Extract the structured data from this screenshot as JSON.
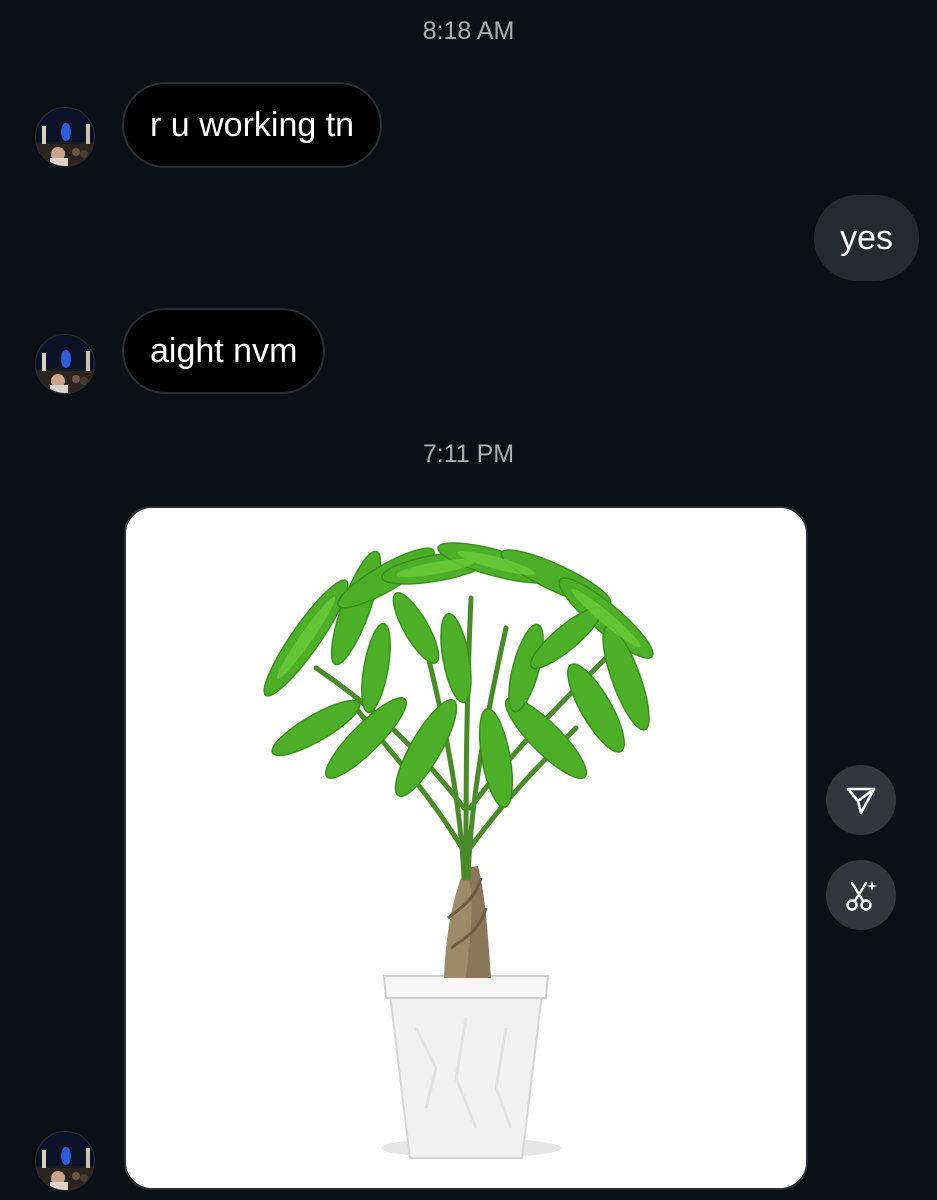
{
  "conversation": {
    "timestamps": [
      "8:18 AM",
      "7:11 PM"
    ],
    "messages": [
      {
        "sender": "them",
        "text": "r u working tn"
      },
      {
        "sender": "me",
        "text": "yes"
      },
      {
        "sender": "them",
        "text": "aight nvm"
      },
      {
        "sender": "them",
        "type": "photo",
        "content": "potted money tree plant in white pot"
      }
    ]
  },
  "actions": {
    "share_icon": "paper-plane-icon",
    "remix_icon": "scissors-sparkle-icon"
  },
  "colors": {
    "background": "#0c1014",
    "incoming_bubble": "#000000",
    "outgoing_bubble": "#262a30",
    "timestamp": "#a8acb3",
    "action_button": "#33373d"
  }
}
